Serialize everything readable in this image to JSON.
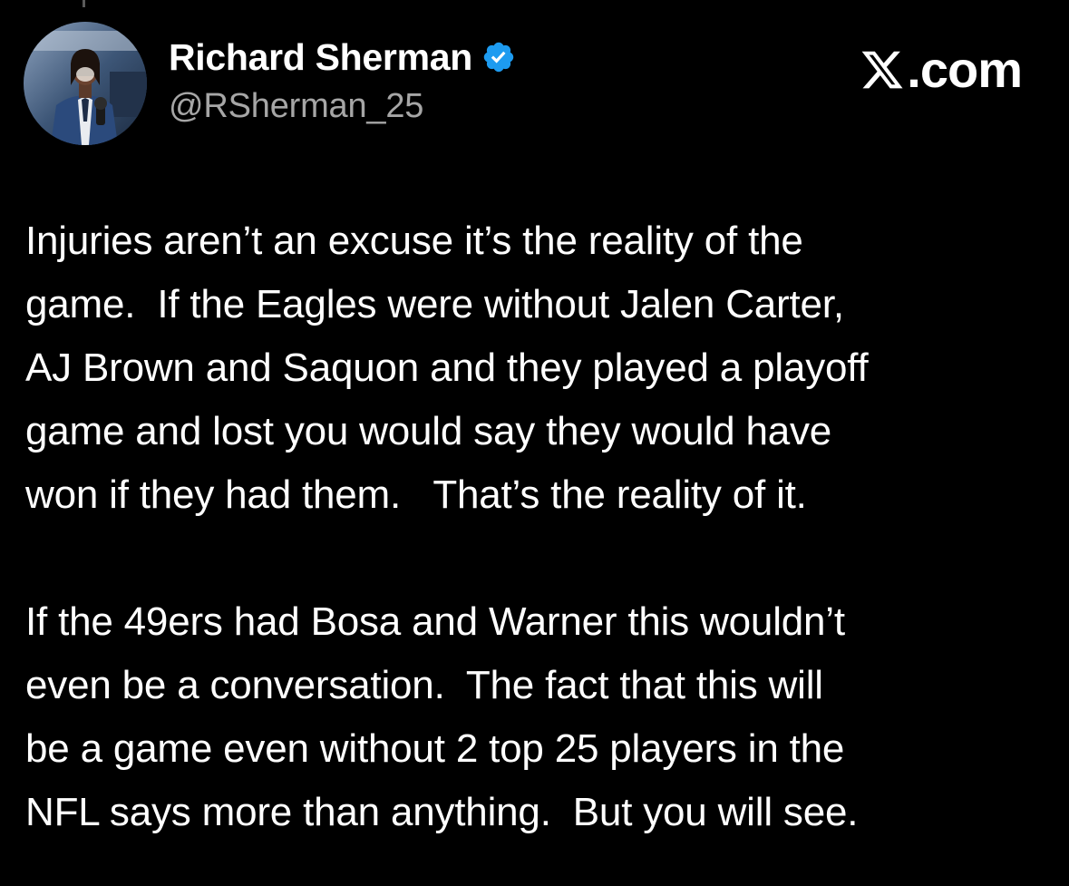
{
  "author": {
    "display_name": "Richard Sherman",
    "handle": "@RSherman_25",
    "verified_icon": "verified-badge-icon",
    "avatar": "profile-photo"
  },
  "brand": {
    "icon": "x-logo-icon",
    "text": ".com"
  },
  "tweet": {
    "paragraphs": [
      "Injuries aren’t an excuse it’s the reality of the\ngame.  If the Eagles were without Jalen Carter,\nAJ Brown and Saquon and they played a playoff\ngame and lost you would say they would have\nwon if they had them.   That’s the reality of it.",
      "If the 49ers had Bosa and Warner this wouldn’t\neven be a conversation.  The fact that this will\nbe a game even without 2 top 25 players in the\nNFL says more than anything.  But you will see."
    ]
  },
  "colors": {
    "background": "#000000",
    "text": "#ffffff",
    "secondary_text": "#a6a6a6",
    "verified": "#1d9bf0"
  }
}
